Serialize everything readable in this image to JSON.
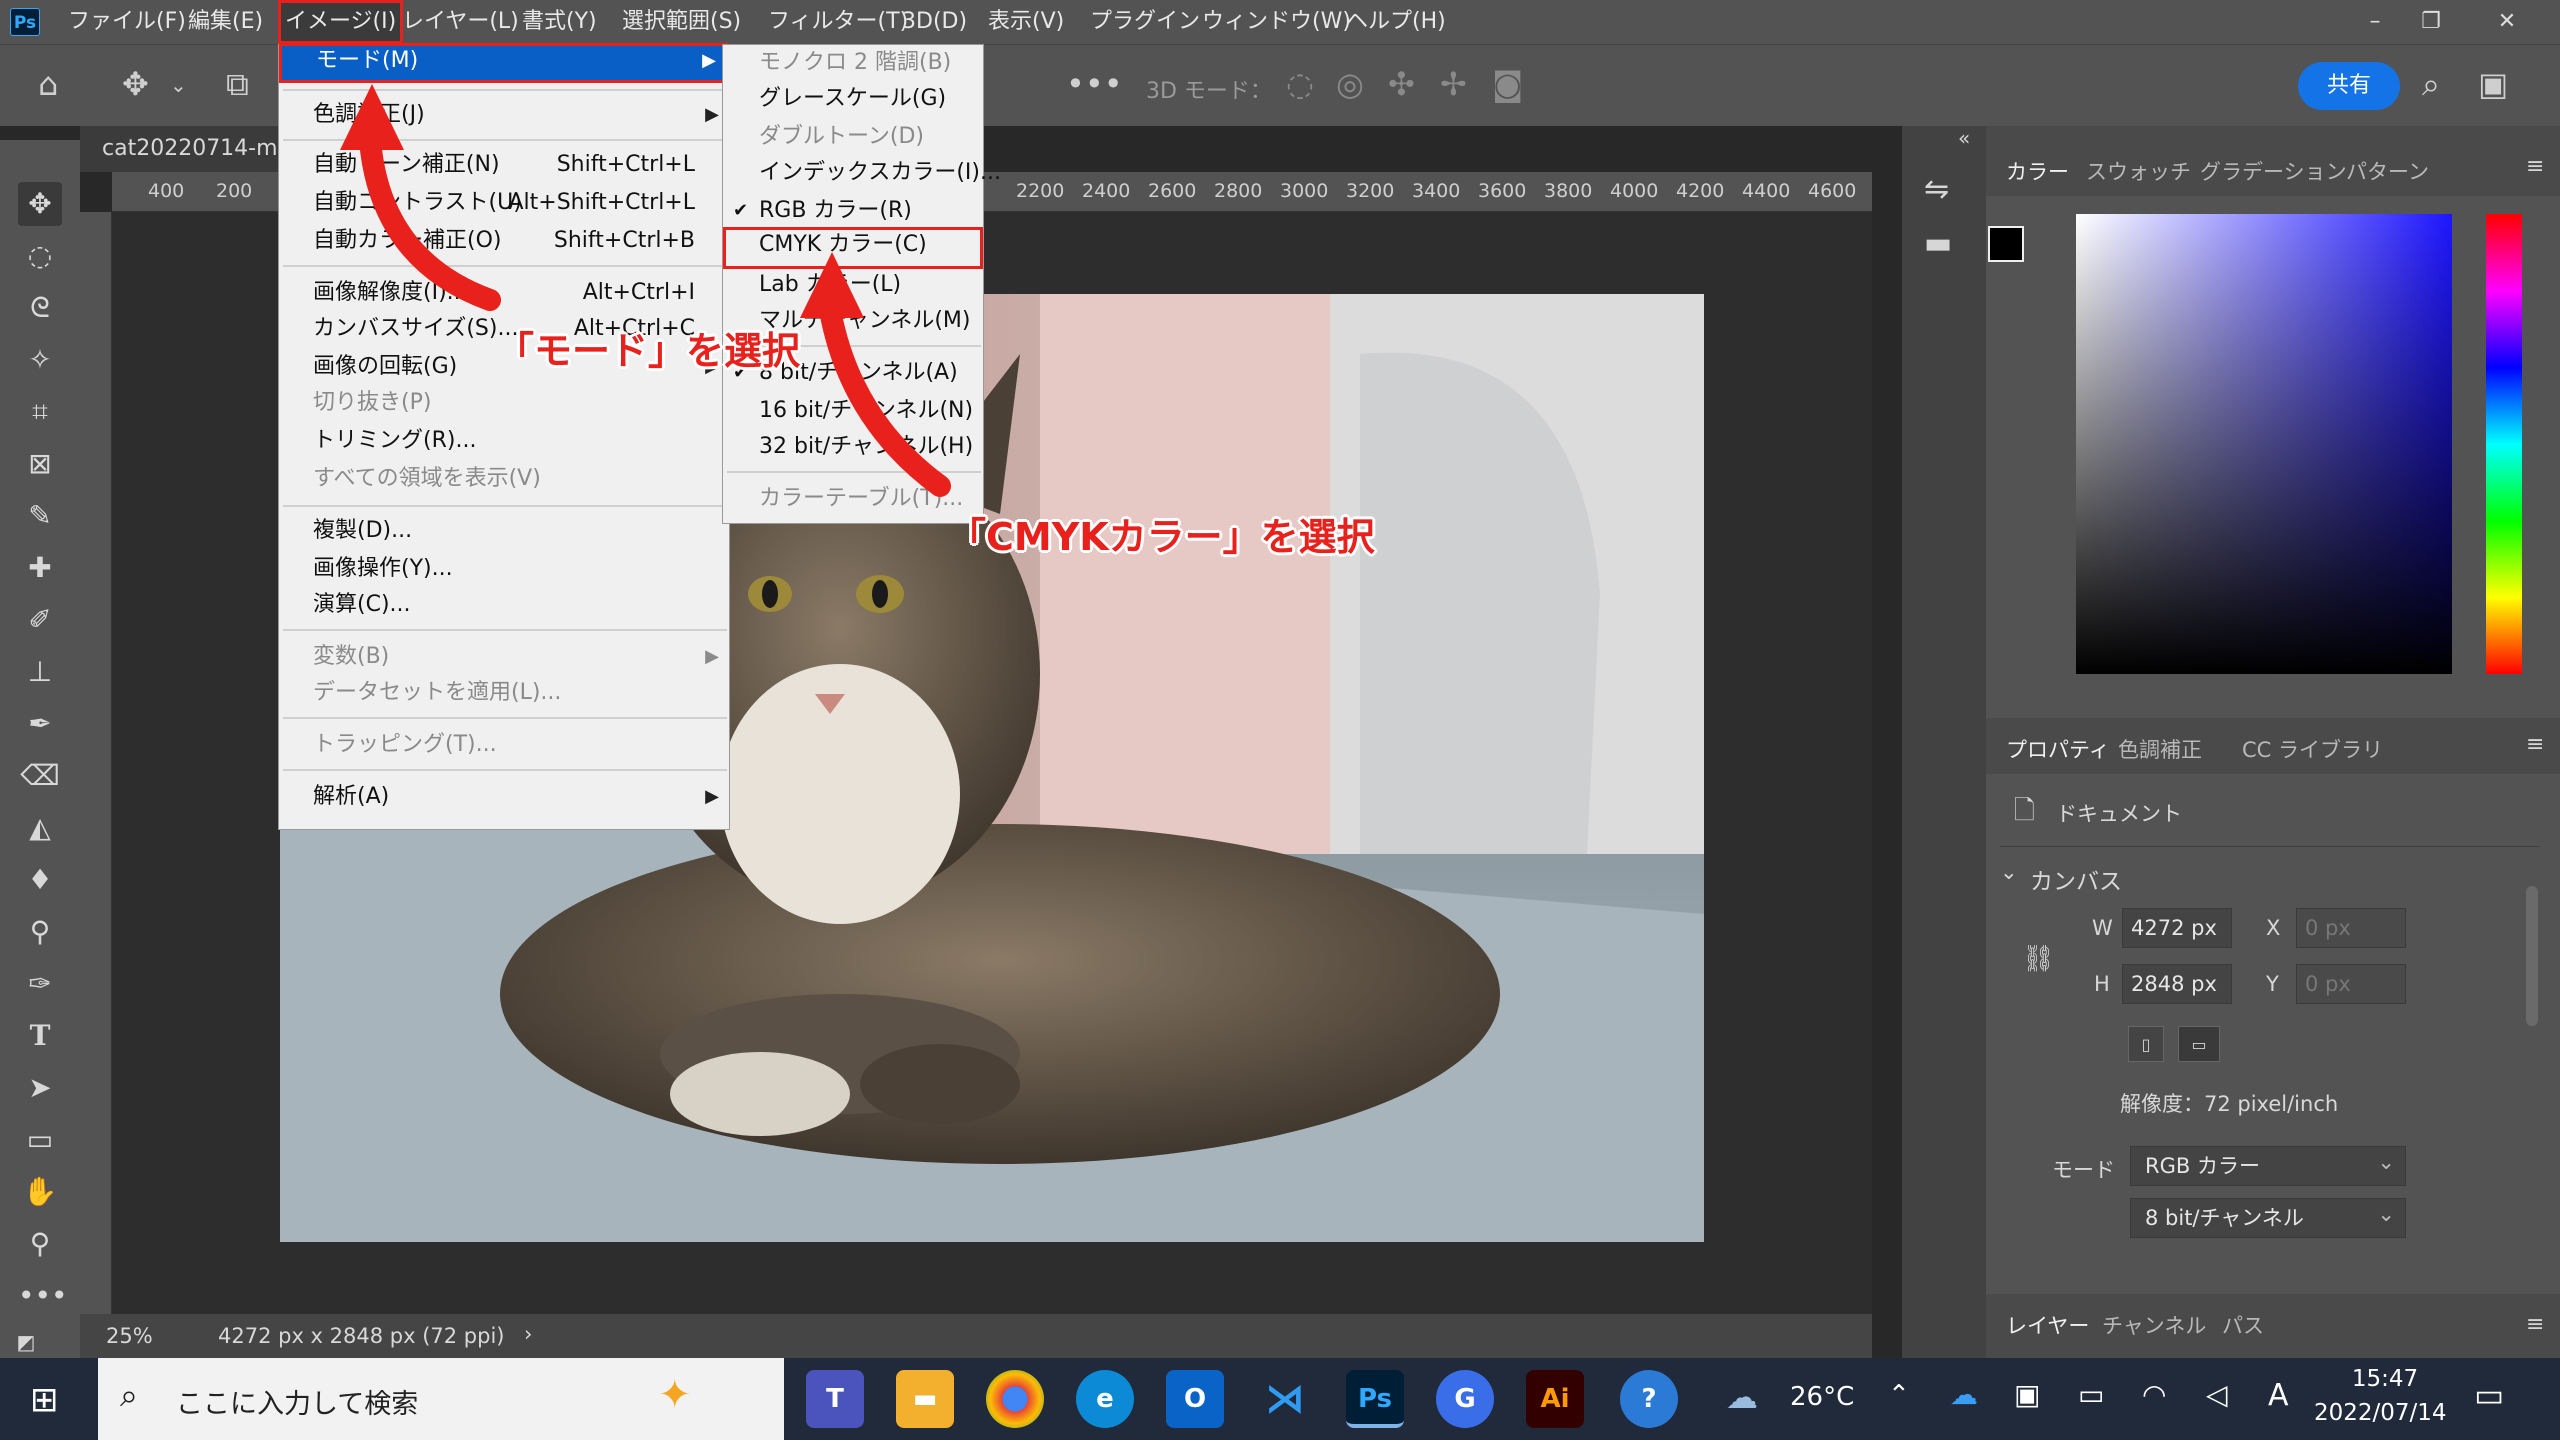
{
  "app": {
    "logo": "Ps",
    "menus": [
      "ファイル(F)",
      "編集(E)",
      "イメージ(I)",
      "レイヤー(L)",
      "書式(Y)",
      "選択範囲(S)",
      "フィルター(T)",
      "3D(D)",
      "表示(V)",
      "プラグイン",
      "ウィンドウ(W)",
      "ヘルプ(H)"
    ]
  },
  "options": {
    "mode3d": "3D モード：",
    "share": "共有"
  },
  "doc": {
    "tab": "cat20220714-mi",
    "zoom": "25%",
    "info": "4272 px x 2848 px (72 ppi)"
  },
  "ruler": [
    "400",
    "200",
    "2200",
    "2400",
    "2600",
    "2800",
    "3000",
    "3200",
    "3400",
    "3600",
    "3800",
    "4000",
    "4200",
    "4400",
    "4600"
  ],
  "menu": {
    "items": [
      {
        "label": "モード(M)",
        "shortcut": "",
        "arrow": "▶"
      },
      {
        "label": "色調補正(J)",
        "shortcut": "",
        "arrow": "▶"
      },
      {
        "label": "自動トーン補正(N)",
        "shortcut": "Shift+Ctrl+L"
      },
      {
        "label": "自動コントラスト(U)",
        "shortcut": "Alt+Shift+Ctrl+L"
      },
      {
        "label": "自動カラー補正(O)",
        "shortcut": "Shift+Ctrl+B"
      },
      {
        "label": "画像解像度(I)...",
        "shortcut": "Alt+Ctrl+I"
      },
      {
        "label": "カンバスサイズ(S)...",
        "shortcut": "Alt+Ctrl+C"
      },
      {
        "label": "画像の回転(G)",
        "shortcut": "",
        "arrow": "▶"
      },
      {
        "label": "切り抜き(P)",
        "shortcut": ""
      },
      {
        "label": "トリミング(R)...",
        "shortcut": ""
      },
      {
        "label": "すべての領域を表示(V)",
        "shortcut": ""
      },
      {
        "label": "複製(D)...",
        "shortcut": ""
      },
      {
        "label": "画像操作(Y)...",
        "shortcut": ""
      },
      {
        "label": "演算(C)...",
        "shortcut": ""
      },
      {
        "label": "変数(B)",
        "shortcut": "",
        "arrow": "▶"
      },
      {
        "label": "データセットを適用(L)...",
        "shortcut": ""
      },
      {
        "label": "トラッピング(T)...",
        "shortcut": ""
      },
      {
        "label": "解析(A)",
        "shortcut": "",
        "arrow": "▶"
      }
    ]
  },
  "submenu": {
    "items": [
      "モノクロ 2 階調(B)",
      "グレースケール(G)",
      "ダブルトーン(D)",
      "インデックスカラー(I)...",
      "RGB カラー(R)",
      "CMYK カラー(C)",
      "Lab カラー(L)",
      "マルチチャンネル(M)",
      "8 bit/チャンネル(A)",
      "16 bit/チャンネル(N)",
      "32 bit/チャンネル(H)",
      "カラーテーブル(T)..."
    ],
    "check": "✔"
  },
  "annotations": {
    "mode": "「モード」を選択",
    "cmyk": "「CMYKカラー」を選択"
  },
  "panels": {
    "color_tabs": [
      "カラー",
      "スウォッチ",
      "グラデーション",
      "パターン"
    ],
    "prop_tabs": [
      "プロパティ",
      "色調補正",
      "CC ライブラリ"
    ],
    "doc_label": "ドキュメント",
    "canvas_label": "カンバス",
    "w_label": "W",
    "w": "4272 px",
    "h_label": "H",
    "h": "2848 px",
    "x_label": "X",
    "x_ph": "0 px",
    "y_label": "Y",
    "y_ph": "0 px",
    "resolution": "解像度：72 pixel/inch",
    "mode_label": "モード",
    "mode": "RGB カラー",
    "depth": "8 bit/チャンネル",
    "layer_tabs": [
      "レイヤー",
      "チャンネル",
      "パス"
    ]
  },
  "taskbar": {
    "search": "ここに入力して検索",
    "weather": "26°C",
    "time": "15:47",
    "date": "2022/07/14",
    "ime": "A"
  },
  "colors": {
    "accent_red": "#e8211c",
    "menu_hl": "#0a5fc7",
    "share": "#1473e6"
  }
}
